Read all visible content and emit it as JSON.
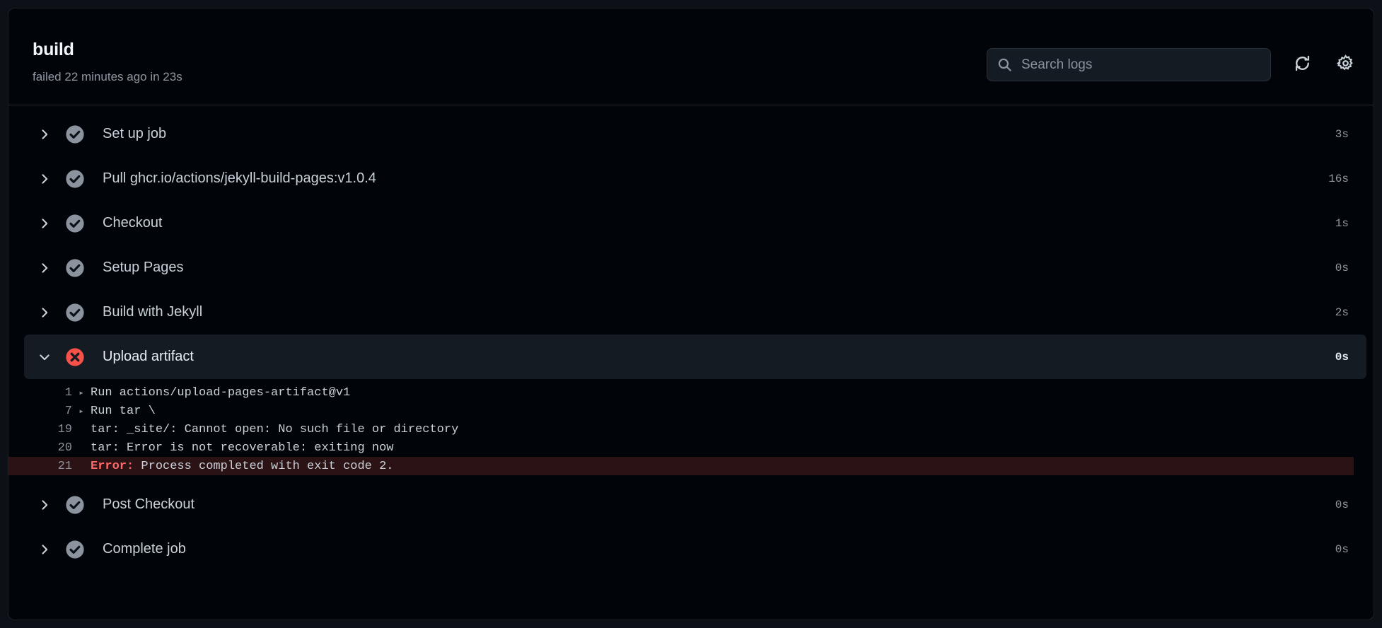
{
  "header": {
    "job_name": "build",
    "status_text": "failed 22 minutes ago in 23s",
    "search_placeholder": "Search logs",
    "search_value": "",
    "refresh_label": "refresh-logs",
    "settings_label": "log-settings"
  },
  "steps": [
    {
      "name": "Set up job",
      "duration": "3s",
      "status": "success",
      "expanded": false
    },
    {
      "name": "Pull ghcr.io/actions/jekyll-build-pages:v1.0.4",
      "duration": "16s",
      "status": "success",
      "expanded": false
    },
    {
      "name": "Checkout",
      "duration": "1s",
      "status": "success",
      "expanded": false
    },
    {
      "name": "Setup Pages",
      "duration": "0s",
      "status": "success",
      "expanded": false
    },
    {
      "name": "Build with Jekyll",
      "duration": "2s",
      "status": "success",
      "expanded": false
    },
    {
      "name": "Upload artifact",
      "duration": "0s",
      "status": "failure",
      "expanded": true
    },
    {
      "name": "Post Checkout",
      "duration": "0s",
      "status": "success",
      "expanded": false
    },
    {
      "name": "Complete job",
      "duration": "0s",
      "status": "success",
      "expanded": false
    }
  ],
  "log": [
    {
      "lineno": "1",
      "collapsible": true,
      "text": "Run actions/upload-pages-artifact@v1",
      "error": false
    },
    {
      "lineno": "7",
      "collapsible": true,
      "text": "Run tar \\",
      "error": false
    },
    {
      "lineno": "19",
      "collapsible": false,
      "text": "tar: _site/: Cannot open: No such file or directory",
      "error": false
    },
    {
      "lineno": "20",
      "collapsible": false,
      "text": "tar: Error is not recoverable: exiting now",
      "error": false
    },
    {
      "lineno": "21",
      "collapsible": false,
      "text": "Error: Process completed with exit code 2.",
      "error": true,
      "error_prefix": "Error:",
      "error_rest": " Process completed with exit code 2."
    }
  ],
  "colors": {
    "page_bg": "#0d1117",
    "panel_bg": "#010409",
    "selected_row": "#151b23",
    "error_row": "#2a1215",
    "success_icon": "#8b949e",
    "failure_icon": "#f85149",
    "error_text": "#ff6a69"
  },
  "glyphs": {
    "collapse_arrow": "▸"
  }
}
